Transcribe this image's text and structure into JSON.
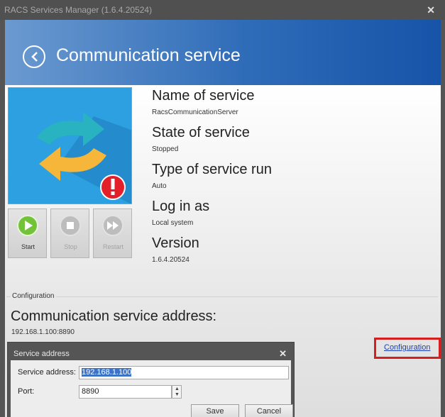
{
  "window": {
    "title": "RACS Services Manager (1.6.4.20524)",
    "close": "✕"
  },
  "header": {
    "title": "Communication service"
  },
  "service": {
    "fields": [
      {
        "label": "Name of service",
        "value": "RacsCommunicationServer"
      },
      {
        "label": "State of service",
        "value": "Stopped"
      },
      {
        "label": "Type of service run",
        "value": "Auto"
      },
      {
        "label": "Log in as",
        "value": "Local system"
      },
      {
        "label": "Version",
        "value": "1.6.4.20524"
      }
    ],
    "status_icon": "warning-icon",
    "colors": {
      "image_bg": "#2ca0e0",
      "arrow_teal": "#29b3c0",
      "arrow_yellow": "#f5b63a",
      "alert_red": "#e3202a"
    }
  },
  "controls": {
    "start": "Start",
    "stop": "Stop",
    "restart": "Restart"
  },
  "configuration": {
    "section_label": "Configuration",
    "address_title": "Communication service address:",
    "address_value": "192.168.1.100:8890",
    "link": "Configuration"
  },
  "dialog": {
    "title": "Service address",
    "close": "✕",
    "address_label": "Service address:",
    "address_value": "192.168.1.100",
    "port_label": "Port:",
    "port_value": "8890",
    "save": "Save",
    "cancel": "Cancel"
  }
}
